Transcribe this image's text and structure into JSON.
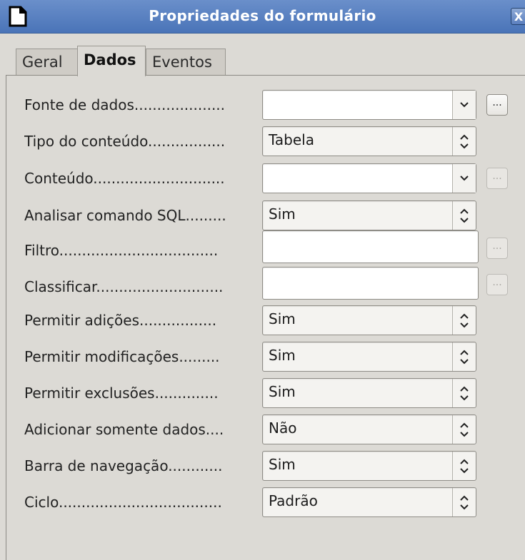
{
  "window": {
    "title": "Propriedades do formulário",
    "close_label": "X",
    "app_icon": "document-icon"
  },
  "tabs": [
    {
      "label": "Geral",
      "active": false
    },
    {
      "label": "Dados",
      "active": true
    },
    {
      "label": "Eventos",
      "active": false
    }
  ],
  "fields": [
    {
      "label": "Fonte de dados....................",
      "control": "combo",
      "value": "",
      "dots_button": "...",
      "dots_enabled": true
    },
    {
      "label": "Tipo do conteúdo.................",
      "control": "listbox",
      "value": "Tabela"
    },
    {
      "label": "Conteúdo.............................",
      "control": "combo",
      "value": "",
      "dots_button": "...",
      "dots_enabled": false
    },
    {
      "label": "Analisar comando SQL.........",
      "control": "listbox",
      "value": "Sim"
    },
    {
      "label": "Filtro...................................",
      "control": "text",
      "value": "",
      "dots_button": "...",
      "dots_enabled": false
    },
    {
      "label": "Classificar............................",
      "control": "text",
      "value": "",
      "dots_button": "...",
      "dots_enabled": false
    },
    {
      "label": "Permitir adições.................",
      "control": "listbox",
      "value": "Sim"
    },
    {
      "label": "Permitir modificações.........",
      "control": "listbox",
      "value": "Sim"
    },
    {
      "label": "Permitir exclusões..............",
      "control": "listbox",
      "value": "Sim"
    },
    {
      "label": "Adicionar somente dados....",
      "control": "listbox",
      "value": "Não"
    },
    {
      "label": "Barra de navegação............",
      "control": "listbox",
      "value": "Sim"
    },
    {
      "label": "Ciclo....................................",
      "control": "listbox",
      "value": "Padrão"
    }
  ]
}
